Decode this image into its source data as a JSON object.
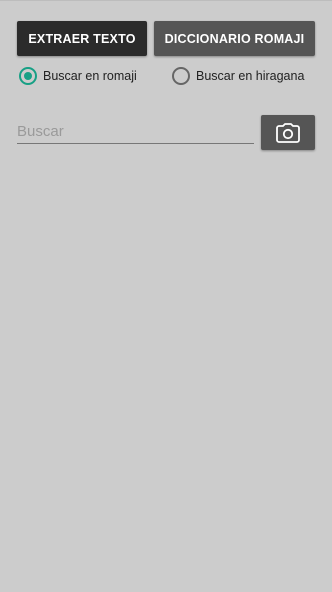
{
  "buttons": {
    "extract_text": "EXTRAER TEXTO",
    "romaji_dictionary": "DICCIONARIO ROMAJI"
  },
  "search_mode": {
    "options": [
      {
        "label": "Buscar en romaji",
        "selected": true
      },
      {
        "label": "Buscar en hiragana",
        "selected": false
      }
    ]
  },
  "search": {
    "placeholder": "Buscar",
    "value": ""
  },
  "camera_button": {
    "icon": "camera-icon"
  },
  "colors": {
    "background": "#cccccc",
    "primary_button": "#2b2b2b",
    "secondary_button": "#555555",
    "accent": "#17a085"
  }
}
